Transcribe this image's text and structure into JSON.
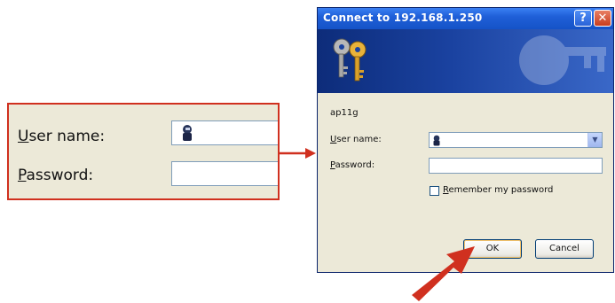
{
  "callout": {
    "user_label_first": "U",
    "user_label_rest": "ser name:",
    "password_label_first": "P",
    "password_label_rest": "assword:"
  },
  "dialog": {
    "title": "Connect to 192.168.1.250",
    "help_glyph": "?",
    "close_glyph": "✕",
    "site": "ap11g",
    "user_label_first": "U",
    "user_label_rest": "ser name:",
    "password_label_first": "P",
    "password_label_rest": "assword:",
    "remember_first": "R",
    "remember_rest": "emember my password",
    "ok_label": "OK",
    "cancel_label": "Cancel",
    "combo_arrow_glyph": "▼"
  },
  "colors": {
    "callout_border": "#d0301f",
    "arrow": "#d0301f",
    "titlebar": "#1f5fd8"
  },
  "icons": [
    "user-icon",
    "keys-icon",
    "help-icon",
    "close-icon",
    "dropdown-arrow-icon",
    "arrow-icon"
  ]
}
